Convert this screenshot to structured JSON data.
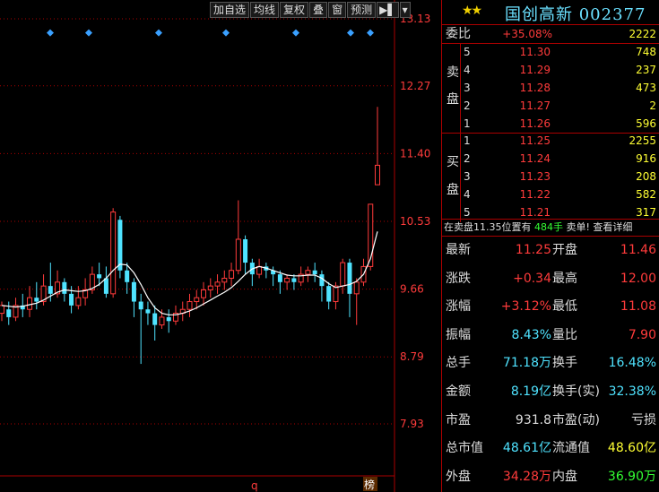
{
  "toolbar": [
    "加自选",
    "均线",
    "复权",
    "叠",
    "窗",
    "预测"
  ],
  "axis_labels": [
    "13.13",
    "12.27",
    "11.40",
    "10.53",
    "9.66",
    "8.79",
    "7.93"
  ],
  "bottom_marks": {
    "q": "q",
    "rank": "榜"
  },
  "header": {
    "name": "国创高新",
    "code": "002377"
  },
  "weibi": {
    "label": "委比",
    "pct": "+35.08%",
    "diff": "2222"
  },
  "sell": {
    "label_top": "卖",
    "label_bottom": "盘",
    "levels": [
      {
        "lvl": "5",
        "price": "11.30",
        "vol": "748"
      },
      {
        "lvl": "4",
        "price": "11.29",
        "vol": "237"
      },
      {
        "lvl": "3",
        "price": "11.28",
        "vol": "473"
      },
      {
        "lvl": "2",
        "price": "11.27",
        "vol": "2"
      },
      {
        "lvl": "1",
        "price": "11.26",
        "vol": "596"
      }
    ]
  },
  "buy": {
    "label_top": "买",
    "label_bottom": "盘",
    "levels": [
      {
        "lvl": "1",
        "price": "11.25",
        "vol": "2255"
      },
      {
        "lvl": "2",
        "price": "11.24",
        "vol": "916"
      },
      {
        "lvl": "3",
        "price": "11.23",
        "vol": "208"
      },
      {
        "lvl": "4",
        "price": "11.22",
        "vol": "582"
      },
      {
        "lvl": "5",
        "price": "11.21",
        "vol": "317"
      }
    ]
  },
  "notice": {
    "text": "在卖盘11.35位置有",
    "qty": "484手",
    "tail": "卖单! 查看详细"
  },
  "stats": [
    {
      "l1": "最新",
      "v1": "11.25",
      "l2": "开盘",
      "v2": "11.46"
    },
    {
      "l1": "涨跌",
      "v1": "+0.34",
      "l2": "最高",
      "v2": "12.00"
    },
    {
      "l1": "涨幅",
      "v1": "+3.12%",
      "l2": "最低",
      "v2": "11.08"
    },
    {
      "l1": "振幅",
      "v1": "8.43%",
      "l2": "量比",
      "v2": "7.90"
    },
    {
      "l1": "总手",
      "v1": "71.18万",
      "l2": "换手",
      "v2": "16.48%"
    },
    {
      "l1": "金额",
      "v1": "8.19亿",
      "l2": "换手(实)",
      "v2": "32.38%"
    },
    {
      "l1": "市盈",
      "v1": "931.8",
      "l2": "市盈(动)",
      "v2": "亏损"
    },
    {
      "l1": "总市值",
      "v1": "48.61亿",
      "l2": "流通值",
      "v2": "48.60亿"
    },
    {
      "l1": "外盘",
      "v1": "34.28万",
      "l2": "内盘",
      "v2": "36.90万"
    }
  ],
  "colors": {
    "up": "#ff3b3b",
    "down": "#4fe3ff",
    "ma": "#ffffff",
    "grid": "#aa0000"
  },
  "chart_data": {
    "type": "candlestick",
    "price_axis": [
      13.13,
      12.27,
      11.4,
      10.53,
      9.66,
      8.79,
      7.93
    ],
    "candles": [
      [
        9.35,
        9.45,
        9.25,
        9.5
      ],
      [
        9.4,
        9.3,
        9.2,
        9.5
      ],
      [
        9.3,
        9.45,
        9.25,
        9.55
      ],
      [
        9.45,
        9.4,
        9.3,
        9.6
      ],
      [
        9.4,
        9.55,
        9.3,
        9.7
      ],
      [
        9.55,
        9.5,
        9.4,
        9.75
      ],
      [
        9.5,
        9.7,
        9.45,
        9.85
      ],
      [
        9.7,
        9.6,
        9.5,
        10.0
      ],
      [
        9.6,
        9.75,
        9.55,
        9.9
      ],
      [
        9.75,
        9.6,
        9.5,
        9.8
      ],
      [
        9.6,
        9.45,
        9.35,
        9.7
      ],
      [
        9.45,
        9.55,
        9.4,
        9.7
      ],
      [
        9.55,
        9.65,
        9.45,
        9.8
      ],
      [
        9.65,
        9.85,
        9.6,
        9.95
      ],
      [
        9.85,
        9.8,
        9.7,
        10.0
      ],
      [
        9.8,
        9.6,
        9.55,
        9.95
      ],
      [
        9.6,
        10.65,
        9.55,
        10.7
      ],
      [
        10.55,
        9.9,
        9.8,
        10.6
      ],
      [
        9.9,
        9.75,
        9.6,
        10.0
      ],
      [
        9.75,
        9.5,
        9.3,
        9.8
      ],
      [
        9.5,
        9.4,
        8.7,
        9.6
      ],
      [
        9.4,
        9.35,
        9.2,
        9.5
      ],
      [
        9.35,
        9.2,
        9.0,
        9.45
      ],
      [
        9.2,
        9.3,
        9.15,
        9.4
      ],
      [
        9.3,
        9.25,
        9.1,
        9.4
      ],
      [
        9.25,
        9.35,
        9.2,
        9.45
      ],
      [
        9.35,
        9.4,
        9.25,
        9.5
      ],
      [
        9.4,
        9.5,
        9.3,
        9.6
      ],
      [
        9.5,
        9.55,
        9.4,
        9.65
      ],
      [
        9.55,
        9.65,
        9.45,
        9.75
      ],
      [
        9.65,
        9.7,
        9.55,
        9.8
      ],
      [
        9.7,
        9.75,
        9.6,
        9.85
      ],
      [
        9.75,
        9.8,
        9.65,
        9.9
      ],
      [
        9.8,
        9.9,
        9.7,
        10.0
      ],
      [
        9.9,
        10.3,
        9.85,
        10.8
      ],
      [
        10.3,
        10.0,
        9.85,
        10.35
      ],
      [
        10.0,
        9.85,
        9.7,
        10.05
      ],
      [
        9.85,
        9.95,
        9.8,
        10.05
      ],
      [
        9.95,
        9.9,
        9.8,
        10.0
      ],
      [
        9.9,
        9.85,
        9.7,
        9.95
      ],
      [
        9.85,
        9.75,
        9.6,
        9.9
      ],
      [
        9.75,
        9.8,
        9.65,
        9.85
      ],
      [
        9.8,
        9.75,
        9.65,
        9.85
      ],
      [
        9.75,
        9.85,
        9.7,
        9.95
      ],
      [
        9.85,
        9.9,
        9.75,
        9.95
      ],
      [
        9.9,
        9.85,
        9.75,
        10.0
      ],
      [
        9.85,
        9.7,
        9.5,
        9.9
      ],
      [
        9.7,
        9.5,
        9.4,
        9.75
      ],
      [
        9.5,
        9.7,
        9.4,
        9.75
      ],
      [
        9.7,
        10.0,
        9.6,
        10.05
      ],
      [
        10.0,
        9.6,
        9.3,
        10.05
      ],
      [
        9.6,
        9.75,
        9.2,
        9.8
      ],
      [
        9.75,
        9.95,
        9.7,
        10.05
      ],
      [
        9.95,
        10.75,
        9.9,
        10.75
      ],
      [
        11.0,
        11.25,
        11.08,
        12.0
      ]
    ],
    "ma_line": [
      9.45,
      9.44,
      9.43,
      9.44,
      9.46,
      9.48,
      9.52,
      9.57,
      9.62,
      9.65,
      9.64,
      9.63,
      9.64,
      9.67,
      9.72,
      9.8,
      9.9,
      9.98,
      9.97,
      9.87,
      9.72,
      9.55,
      9.42,
      9.35,
      9.33,
      9.33,
      9.35,
      9.38,
      9.42,
      9.47,
      9.52,
      9.57,
      9.62,
      9.68,
      9.76,
      9.85,
      9.92,
      9.95,
      9.93,
      9.9,
      9.87,
      9.84,
      9.83,
      9.83,
      9.84,
      9.84,
      9.8,
      9.73,
      9.68,
      9.7,
      9.72,
      9.76,
      9.85,
      10.05,
      10.4
    ],
    "markers": [
      12.95,
      12.95,
      12.95,
      12.95,
      12.95,
      12.95,
      12.95
    ]
  }
}
